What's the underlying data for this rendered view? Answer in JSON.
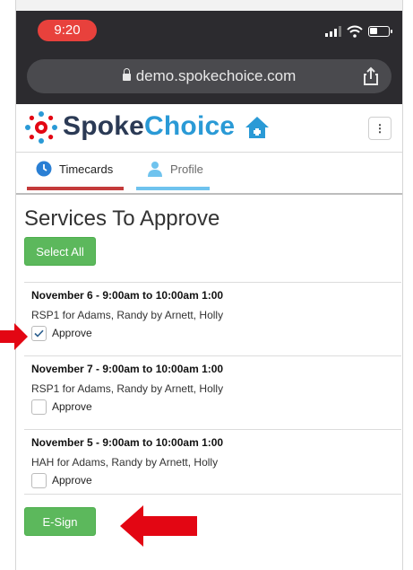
{
  "status_bar": {
    "time": "9:20"
  },
  "browser": {
    "url": "demo.spokechoice.com"
  },
  "brand": {
    "name_part1": "Spoke",
    "name_part2": "Choice",
    "menu_glyph": "⋮"
  },
  "tabs": [
    {
      "label": "Timecards",
      "active": true
    },
    {
      "label": "Profile",
      "active": false
    }
  ],
  "page": {
    "title": "Services To Approve"
  },
  "actions": {
    "select_all_label": "Select All",
    "esign_label": "E-Sign"
  },
  "services": [
    {
      "title": "November 6 - 9:00am to 10:00am 1:00",
      "description": "RSP1 for Adams, Randy by Arnett, Holly",
      "approve_label": "Approve",
      "checked": true
    },
    {
      "title": "November 7 - 9:00am to 10:00am 1:00",
      "description": "RSP1 for Adams, Randy by Arnett, Holly",
      "approve_label": "Approve",
      "checked": false
    },
    {
      "title": "November 5 - 9:00am to 10:00am 1:00",
      "description": "HAH for Adams, Randy by Arnett, Holly",
      "approve_label": "Approve",
      "checked": false
    }
  ],
  "colors": {
    "accent_red": "#e30613",
    "button_green": "#5cb85c",
    "tab_red": "#c43a3a",
    "tab_blue": "#6fc3ee",
    "brand_dark": "#2b3a55",
    "brand_blue": "#2a9ad6"
  }
}
